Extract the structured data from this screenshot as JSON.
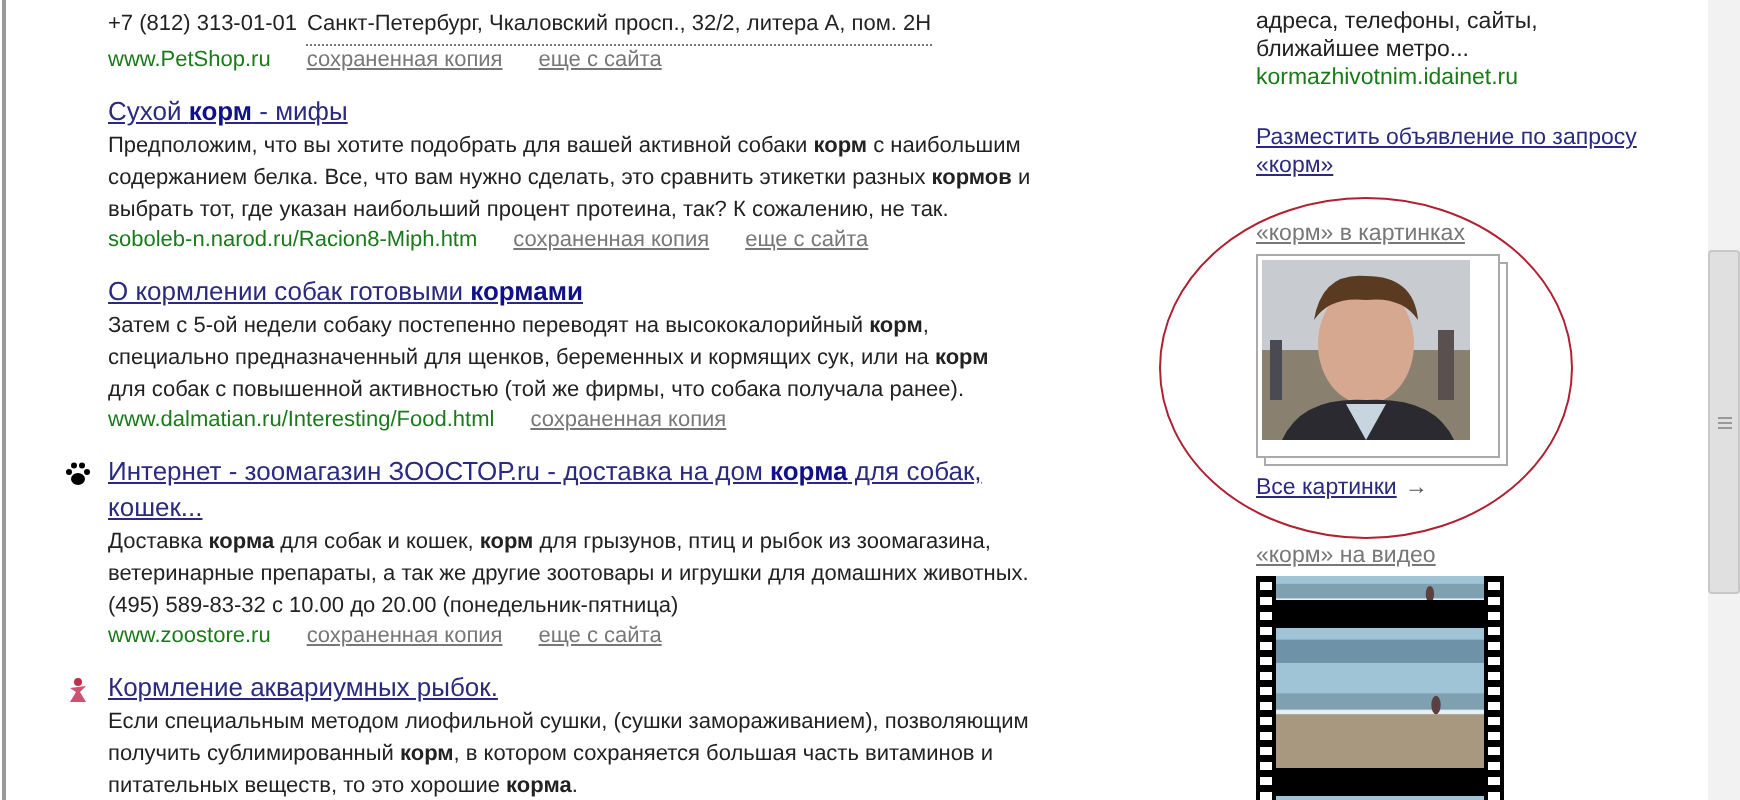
{
  "results": [
    {
      "address": {
        "phone": "+7 (812) 313-01-01",
        "location": "Санкт-Петербург, Чкаловский просп., 32/2, литера А, пом. 2Н"
      },
      "url": "www.PetShop.ru",
      "links": [
        "сохраненная копия",
        "еще с сайта"
      ]
    },
    {
      "title": "Сухой **корм** - мифы",
      "snippet": "Предположим, что вы хотите подобрать для вашей активной собаки **корм** с наибольшим содержанием белка. Все, что вам нужно сделать, это сравнить этикетки разных **кормов** и выбрать тот, где указан наибольший процент протеина, так? К сожалению, не так.",
      "url": "soboleb-n.narod.ru/Racion8-Miph.htm",
      "links": [
        "сохраненная копия",
        "еще с сайта"
      ]
    },
    {
      "title": "О кормлении собак готовыми **кормами**",
      "snippet": "Затем с 5-ой недели собаку постепенно переводят на высококалорийный **корм**, специально предназначенный для щенков, беременных и кормящих сук, или на **корм** для собак с повышенной активностью (той же фирмы, что собака получала ранее).",
      "url": "www.dalmatian.ru/Interesting/Food.html",
      "links": [
        "сохраненная копия"
      ]
    },
    {
      "kind": "paw",
      "title": "Интернет - зоомагазин ЗООСТОР.ru - доставка на дом **корма** для собак, кошек...",
      "snippet": "Доставка **корма** для собак и кошек, **корм** для грызунов, птиц и рыбок из зоомагазина, ветеринарные препараты, а так же другие зоотовары и игрушки для домашних животных. (495) 589-83-32 с 10.00 до 20.00 (понедельник-пятница)",
      "url": "www.zoostore.ru",
      "links": [
        "сохраненная копия",
        "еще с сайта"
      ]
    },
    {
      "kind": "favicon",
      "title": "Кормление аквариумных рыбок.",
      "snippet": "Если специальным методом лиофильной сушки, (сушки замораживанием), позволяющим получить сублимированный **корм**, в котором сохраняется большая часть витаминов и питательных веществ, то это хорошие **корма**."
    }
  ],
  "ad": {
    "snippet": "адреса, телефоны, сайты, ближайшее метро...",
    "url": "kormazhivotnim.idainet.ru"
  },
  "place_ad_link": "Разместить объявление по запросу «корм»",
  "images": {
    "heading": "«корм» в картинках",
    "all_link": "Все картинки",
    "arrow": "→"
  },
  "video": {
    "heading": "«корм» на видео"
  }
}
